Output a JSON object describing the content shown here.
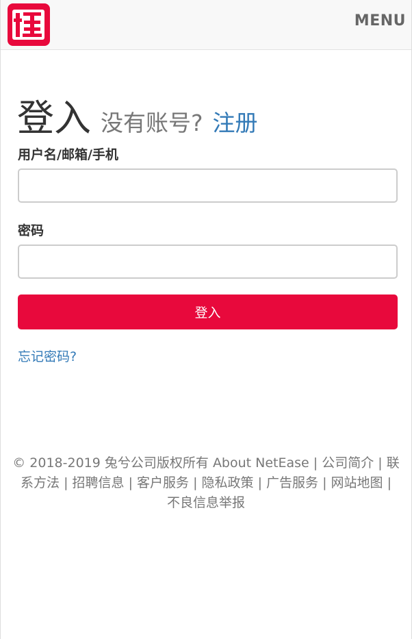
{
  "header": {
    "logo_icon": "guai-logo-icon",
    "logo_color": "#e8093c",
    "menu_label": "MENU"
  },
  "login": {
    "title": "登入",
    "no_account": "没有账号?",
    "register_link": "注册",
    "username_label": "用户名/邮箱/手机",
    "username_value": "",
    "password_label": "密码",
    "password_value": "",
    "submit_label": "登入",
    "submit_color": "#e8093c",
    "forgot_link": "忘记密码?",
    "link_color": "#337ab7"
  },
  "footer": {
    "copyright": "© 2018-2019 兔兮公司版权所有",
    "links": [
      "About NetEase",
      "公司简介",
      "联系方法",
      "招聘信息",
      "客户服务",
      "隐私政策",
      "广告服务",
      "网站地图",
      "不良信息举报"
    ]
  }
}
